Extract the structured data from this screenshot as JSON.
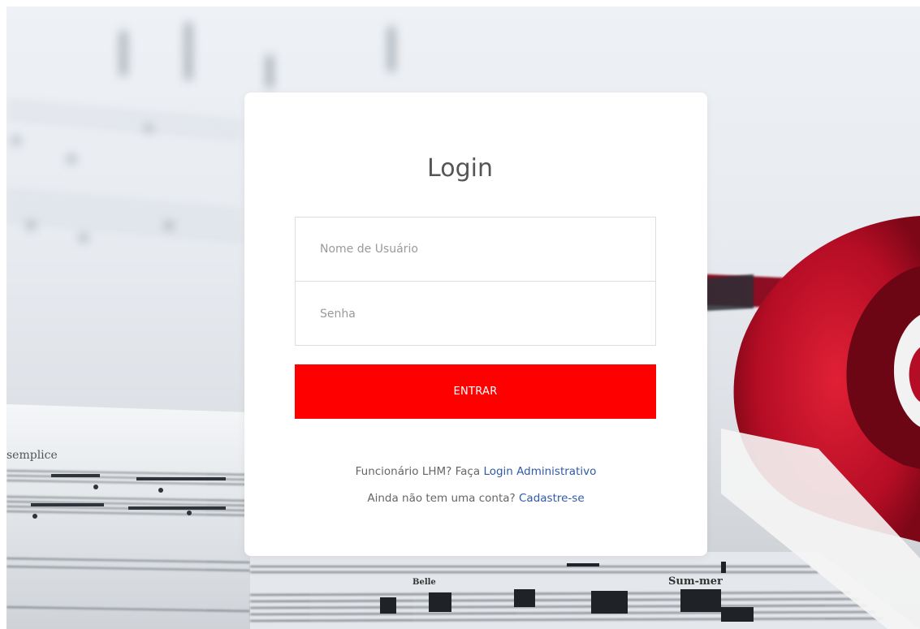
{
  "login": {
    "title": "Login",
    "username_placeholder": "Nome de Usuário",
    "password_placeholder": "Senha",
    "submit_label": "ENTRAR",
    "staff_prompt": "Funcionário LHM? Faça",
    "staff_link": "Login Administrativo",
    "signup_prompt": "Ainda não tem uma conta?",
    "signup_link": "Cadastre-se"
  },
  "background": {
    "sheet_music_words": [
      "semplice",
      "Belle",
      "Sum-mer"
    ]
  },
  "colors": {
    "accent": "#ff0000",
    "link": "#2f5aa8",
    "headphone": "#c8102e"
  }
}
